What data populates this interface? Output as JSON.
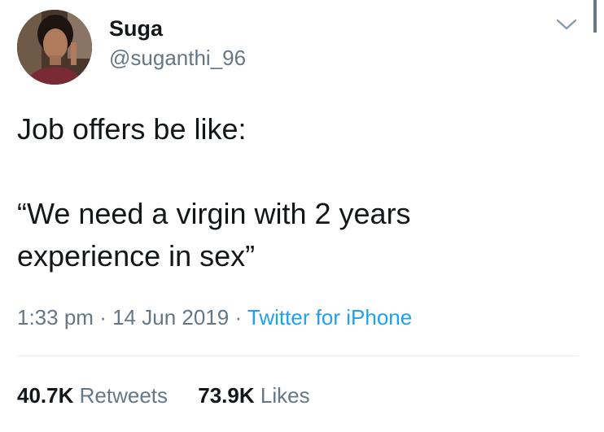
{
  "user": {
    "display_name": "Suga",
    "handle": "@suganthi_96"
  },
  "tweet": {
    "text": "Job offers be like:\n\n“We need a virgin with 2 years\nexperience in sex”"
  },
  "meta": {
    "time": "1:33 pm",
    "separator": "·",
    "date": "14 Jun 2019",
    "source": "Twitter for iPhone"
  },
  "stats": {
    "retweets_count": "40.7K",
    "retweets_label": "Retweets",
    "likes_count": "73.9K",
    "likes_label": "Likes"
  },
  "icons": {
    "menu": "chevron-down-icon"
  },
  "colors": {
    "text": "#14171a",
    "secondary": "#657786",
    "link": "#1da1f2",
    "divider": "#e6ecf0"
  }
}
